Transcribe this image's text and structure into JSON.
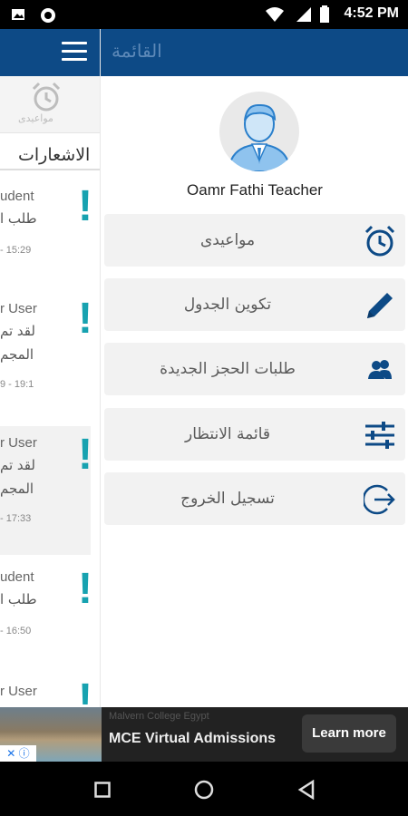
{
  "status_bar": {
    "time": "4:52 PM"
  },
  "background_screen": {
    "tab_label": "مواعيدى",
    "section_title": "الاشعارات",
    "notifications": [
      {
        "user": "udent",
        "line1": "طلب ا",
        "line2": "",
        "time": "- 15:29"
      },
      {
        "user": "r User",
        "line1": "لقد تم",
        "line2": "المجم",
        "time": "9 - 19:1"
      },
      {
        "user": "r User",
        "line1": "لقد تم",
        "line2": "المجم",
        "time": "- 17:33"
      },
      {
        "user": "udent",
        "line1": "طلب ا",
        "line2": "",
        "time": "- 16:50"
      },
      {
        "user": "r User",
        "line1": "",
        "line2": "",
        "time": ""
      }
    ]
  },
  "drawer": {
    "title": "القائمة",
    "user_name": "Oamr Fathi Teacher",
    "menu": [
      {
        "label": "مواعيدى",
        "icon": "alarm-clock-icon"
      },
      {
        "label": "تكوين الجدول",
        "icon": "pencil-icon"
      },
      {
        "label": "طلبات الحجز الجديدة",
        "icon": "users-icon"
      },
      {
        "label": "قائمة الانتظار",
        "icon": "sliders-icon"
      },
      {
        "label": "تسجيل الخروج",
        "icon": "logout-icon"
      }
    ]
  },
  "ad": {
    "advertiser": "Malvern College Egypt",
    "headline": "MCE Virtual Admissions",
    "cta": "Learn more"
  },
  "colors": {
    "header": "#0d4a86",
    "accent": "#17a2b0",
    "icon_blue": "#0d4a86"
  }
}
